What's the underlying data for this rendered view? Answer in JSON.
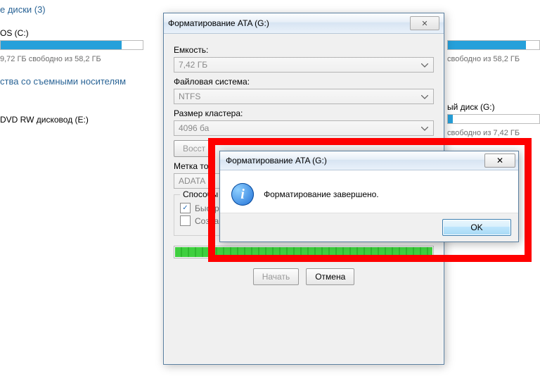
{
  "bg": {
    "disks_heading": "е диски (3)",
    "os_drive_label": "OS (C:)",
    "os_free": "9,72 ГБ свободно из 58,2 ГБ",
    "removable_heading": "ства со съемными носителям",
    "dvd_label": "DVD RW дисковод (E:)",
    "right_free_c": "свободно из 58,2 ГБ",
    "right_drive_g": "ый диск (G:)",
    "right_free_g": "свободно из 7,42 ГБ"
  },
  "format_dialog": {
    "title": "Форматирование ATA (G:)",
    "labels": {
      "capacity": "Емкость:",
      "filesystem": "Файловая система:",
      "cluster": "Размер кластера:",
      "restore": "Восст",
      "volume": "Метка то",
      "methods": "Способы"
    },
    "values": {
      "capacity": "7,42 ГБ",
      "filesystem": "NTFS",
      "cluster": "4096 ба",
      "volume": "ADATA"
    },
    "options": {
      "quick": "Быстрое (очистка оглавления)",
      "msdos": "Создание загрузочного диска MS-DOS"
    },
    "buttons": {
      "start": "Начать",
      "cancel": "Отмена"
    }
  },
  "msgbox": {
    "title": "Форматирование ATA (G:)",
    "text": "Форматирование завершено.",
    "ok": "OK"
  }
}
